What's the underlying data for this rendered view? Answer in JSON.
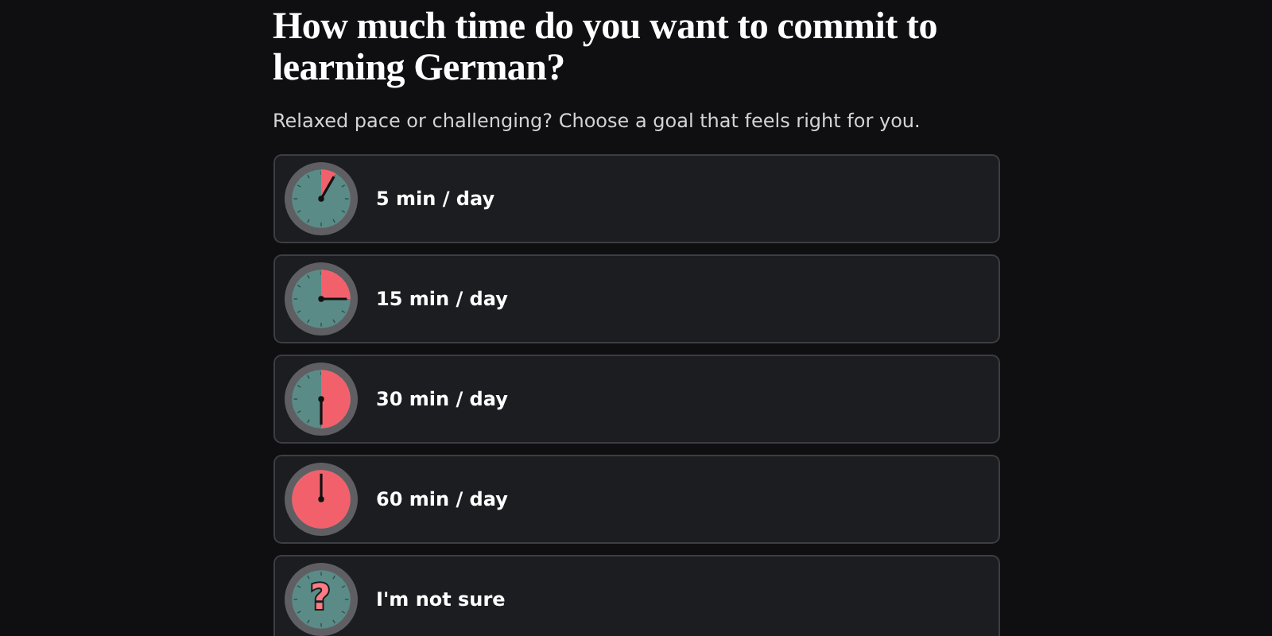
{
  "title": "How much time do you want to commit to learning German?",
  "subtitle": "Relaxed pace or challenging? Choose a goal that feels right for you.",
  "options": [
    {
      "label": "5 min / day",
      "kind": "twelfth"
    },
    {
      "label": "15 min / day",
      "kind": "quarter"
    },
    {
      "label": "30 min / day",
      "kind": "half"
    },
    {
      "label": "60 min / day",
      "kind": "full"
    },
    {
      "label": "I'm not sure",
      "kind": "unknown",
      "icon_text": "?"
    }
  ]
}
